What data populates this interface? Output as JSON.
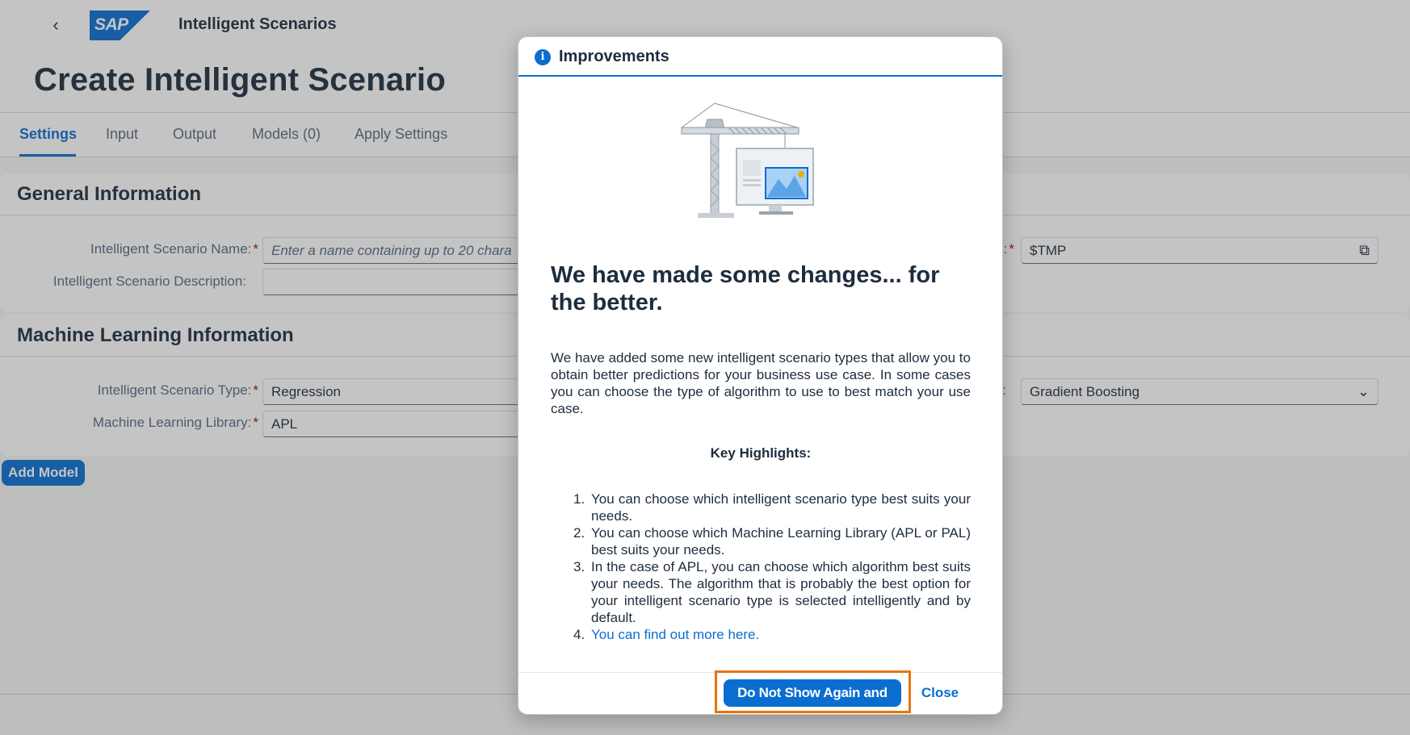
{
  "shell": {
    "back_icon": "chevron-left-icon",
    "logo_text": "SAP",
    "title": "Intelligent Scenarios"
  },
  "page": {
    "title": "Create Intelligent Scenario"
  },
  "tabs": [
    {
      "label": "Settings",
      "active": true
    },
    {
      "label": "Input",
      "active": false
    },
    {
      "label": "Output",
      "active": false
    },
    {
      "label": "Models (0)",
      "active": false
    },
    {
      "label": "Apply Settings",
      "active": false
    }
  ],
  "general": {
    "title": "General Information",
    "name_label": "Intelligent Scenario Name:",
    "name_placeholder": "Enter a name containing up to 20 chara",
    "description_label": "Intelligent Scenario Description:",
    "description_value": "",
    "package_label_suffix": ":",
    "package_value": "$TMP",
    "package_icon": "copy-icon"
  },
  "ml": {
    "title": "Machine Learning Information",
    "type_label": "Intelligent Scenario Type:",
    "type_value": "Regression",
    "library_label": "Machine Learning Library:",
    "library_value": "APL",
    "algorithm_label_suffix": ":",
    "algorithm_value": "Gradient Boosting",
    "algorithm_icon": "chevron-down-icon"
  },
  "add_model_label": "Add Model",
  "required_marker": "*",
  "dialog": {
    "title": "Improvements",
    "icon": "info-icon",
    "illustration": "construction-crane-illustration",
    "heading": "We have made some changes... for the better.",
    "intro": "We have added some new intelligent scenario types that allow you to obtain better predictions for your business use case. In some cases you can choose the type of algorithm to use to best match your use case.",
    "key_highlights": "Key Highlights:",
    "items": [
      {
        "num": "1.",
        "text": "You can choose which intelligent scenario type best suits your needs."
      },
      {
        "num": "2.",
        "text": "You can choose which Machine Learning Library (APL or PAL) best suits your needs."
      },
      {
        "num": "3.",
        "text": "In the case of APL, you can choose which algorithm best suits your needs. The algorithm that is probably the best option for your intelligent scenario type is selected intelligently and by default."
      },
      {
        "num": "4.",
        "text": "You can find out more here."
      }
    ],
    "primary_button": "Do Not Show Again and Close",
    "close_button": "Close"
  },
  "colors": {
    "accent": "#0a6ed1",
    "highlight": "#e9730c",
    "required": "#aa0808",
    "text": "#1d2d3e"
  }
}
